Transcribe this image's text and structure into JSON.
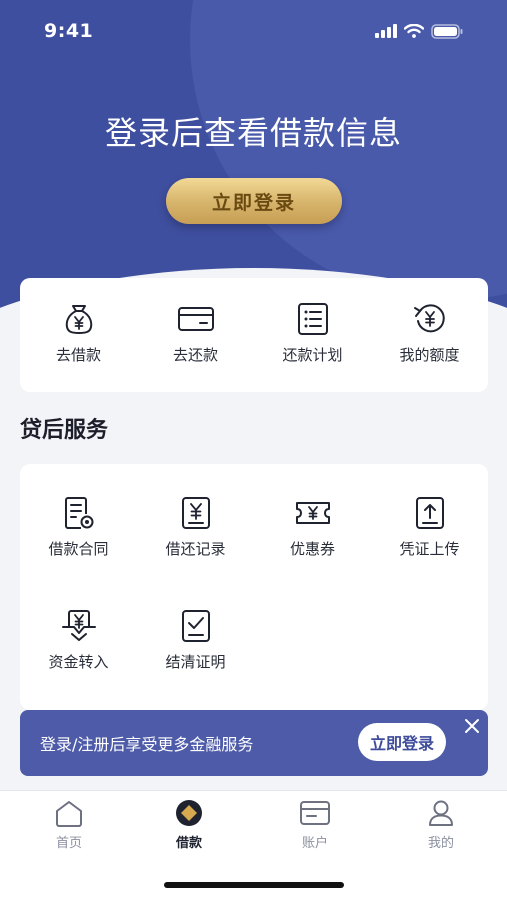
{
  "status_bar": {
    "time": "9:41"
  },
  "hero": {
    "title": "登录后查看借款信息",
    "login_button": "立即登录"
  },
  "quick_actions": [
    {
      "label": "去借款",
      "icon": "money-bag-icon"
    },
    {
      "label": "去还款",
      "icon": "card-icon"
    },
    {
      "label": "还款计划",
      "icon": "list-icon"
    },
    {
      "label": "我的额度",
      "icon": "yuan-refresh-icon"
    }
  ],
  "services": {
    "title": "贷后服务",
    "items": [
      {
        "label": "借款合同",
        "icon": "contract-icon"
      },
      {
        "label": "借还记录",
        "icon": "record-icon"
      },
      {
        "label": "优惠券",
        "icon": "coupon-icon"
      },
      {
        "label": "凭证上传",
        "icon": "upload-icon"
      },
      {
        "label": "资金转入",
        "icon": "transfer-in-icon"
      },
      {
        "label": "结清证明",
        "icon": "certificate-icon"
      }
    ]
  },
  "promo": {
    "text": "登录/注册后享受更多金融服务",
    "button": "立即登录"
  },
  "tabbar": {
    "tabs": [
      {
        "label": "首页",
        "icon": "home-icon",
        "active": false
      },
      {
        "label": "借款",
        "icon": "loan-icon",
        "active": true
      },
      {
        "label": "账户",
        "icon": "wallet-icon",
        "active": false
      },
      {
        "label": "我的",
        "icon": "user-icon",
        "active": false
      }
    ]
  },
  "colors": {
    "brand": "#3f4f9f",
    "gold": "#d6b36a",
    "promo_bg": "#4d5ba8"
  }
}
